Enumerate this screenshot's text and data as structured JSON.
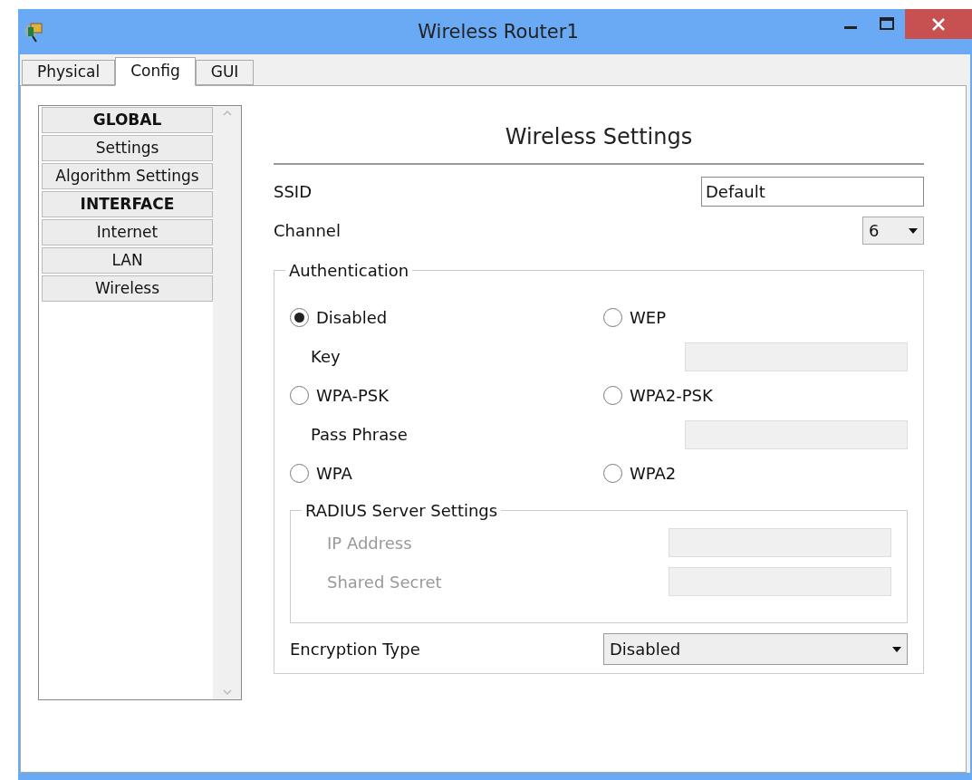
{
  "window": {
    "title": "Wireless Router1"
  },
  "tabs": [
    {
      "label": "Physical",
      "selected": false
    },
    {
      "label": "Config",
      "selected": true
    },
    {
      "label": "GUI",
      "selected": false
    }
  ],
  "sidebar": {
    "items": [
      {
        "label": "GLOBAL",
        "kind": "header"
      },
      {
        "label": "Settings",
        "kind": "item"
      },
      {
        "label": "Algorithm Settings",
        "kind": "item"
      },
      {
        "label": "INTERFACE",
        "kind": "header"
      },
      {
        "label": "Internet",
        "kind": "item"
      },
      {
        "label": "LAN",
        "kind": "item"
      },
      {
        "label": "Wireless",
        "kind": "item"
      }
    ]
  },
  "main": {
    "title": "Wireless Settings",
    "ssid": {
      "label": "SSID",
      "value": "Default"
    },
    "channel": {
      "label": "Channel",
      "value": "6"
    },
    "authentication": {
      "legend": "Authentication",
      "rows": [
        {
          "kind": "radios",
          "options": [
            {
              "label": "Disabled",
              "selected": true
            },
            {
              "label": "WEP",
              "selected": false
            }
          ]
        },
        {
          "kind": "field",
          "label": "Key"
        },
        {
          "kind": "radios",
          "options": [
            {
              "label": "WPA-PSK",
              "selected": false
            },
            {
              "label": "WPA2-PSK",
              "selected": false
            }
          ]
        },
        {
          "kind": "field",
          "label": "Pass Phrase"
        },
        {
          "kind": "radios",
          "options": [
            {
              "label": "WPA",
              "selected": false
            },
            {
              "label": "WPA2",
              "selected": false
            }
          ]
        }
      ],
      "radius": {
        "legend": "RADIUS Server Settings",
        "fields": [
          {
            "label": "IP Address",
            "disabled": true
          },
          {
            "label": "Shared Secret",
            "disabled": true
          }
        ]
      },
      "encryption": {
        "label": "Encryption Type",
        "value": "Disabled"
      }
    }
  }
}
